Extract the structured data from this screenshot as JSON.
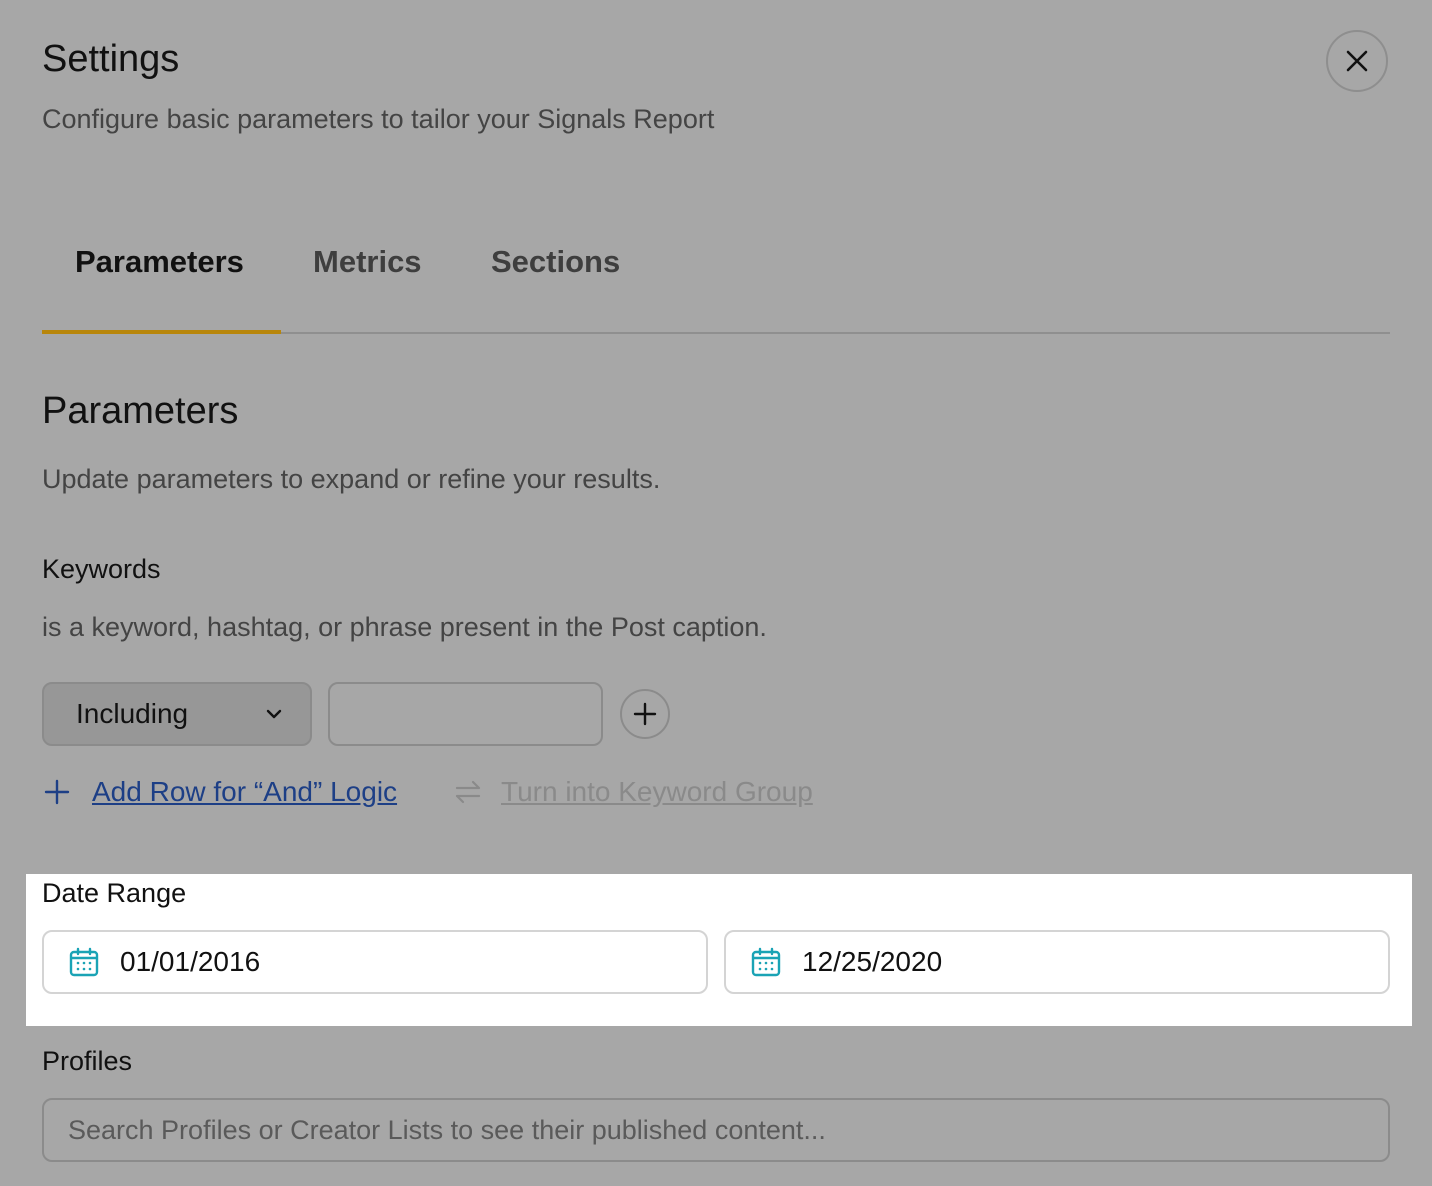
{
  "header": {
    "title": "Settings",
    "subtitle": "Configure basic parameters to tailor your Signals Report",
    "close_icon": "close-icon"
  },
  "tabs": [
    {
      "label": "Parameters",
      "active": true
    },
    {
      "label": "Metrics",
      "active": false
    },
    {
      "label": "Sections",
      "active": false
    }
  ],
  "section": {
    "title": "Parameters",
    "description": "Update parameters to expand or refine your results."
  },
  "keywords": {
    "label": "Keywords",
    "help": "is a keyword, hashtag, or phrase present in the Post caption.",
    "select_value": "Including",
    "input_value": "",
    "add_row_label": "Add Row for “And” Logic",
    "group_label": "Turn into Keyword Group"
  },
  "date_range": {
    "label": "Date Range",
    "start": "01/01/2016",
    "end": "12/25/2020",
    "icon": "calendar-icon"
  },
  "profiles": {
    "label": "Profiles",
    "placeholder": "Search Profiles or Creator Lists to see their published content..."
  },
  "colors": {
    "overlay": "#a7a7a7",
    "tab_accent": "#b8860b",
    "link": "#1d3f86",
    "calendar_icon": "#1aa3b5"
  }
}
